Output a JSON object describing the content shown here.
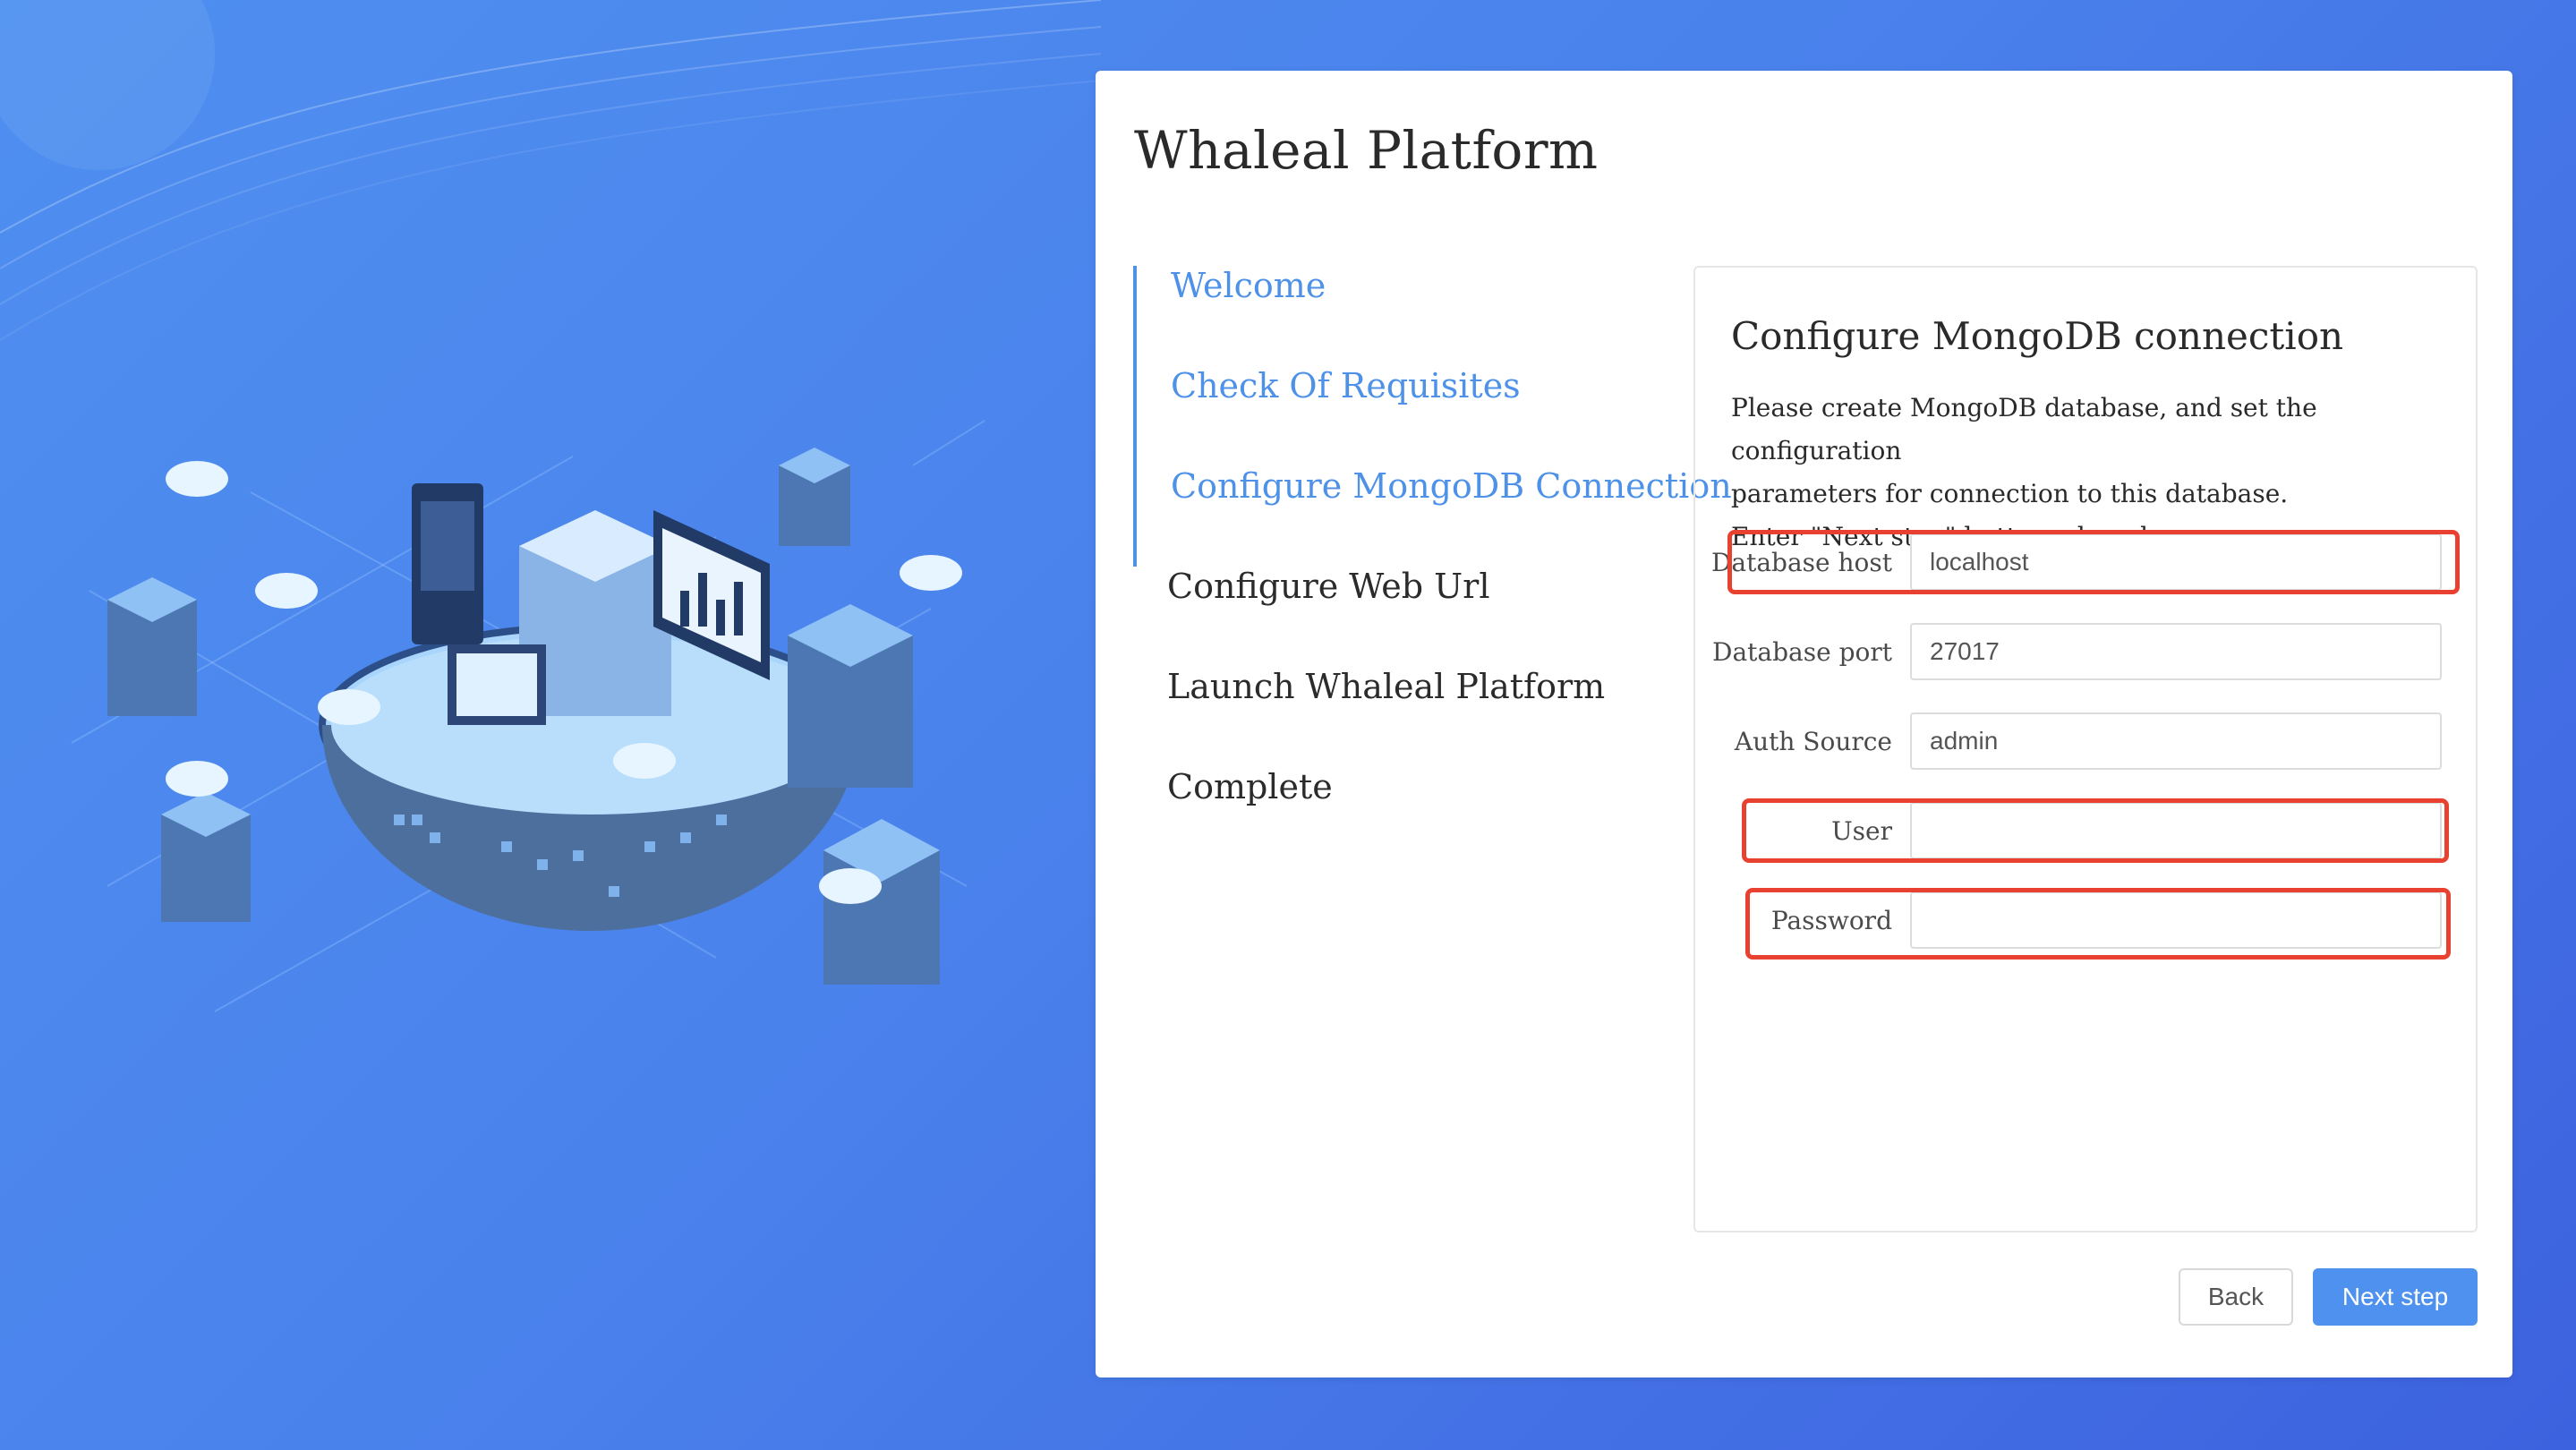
{
  "app": {
    "title": "Whaleal Platform"
  },
  "steps": [
    {
      "label": "Welcome",
      "state": "done"
    },
    {
      "label": "Check Of Requisites",
      "state": "done"
    },
    {
      "label": "Configure MongoDB Connection",
      "state": "current"
    },
    {
      "label": "Configure Web Url",
      "state": "todo"
    },
    {
      "label": "Launch Whaleal Platform",
      "state": "todo"
    },
    {
      "label": "Complete",
      "state": "todo"
    }
  ],
  "panel": {
    "title": "Configure MongoDB connection",
    "description_lines": [
      "Please create MongoDB database, and set the configuration",
      "parameters for connection to this database.",
      "Enter \"Next step\" button when done."
    ],
    "fields": [
      {
        "label": "Database host",
        "value": "localhost",
        "highlighted": true
      },
      {
        "label": "Database port",
        "value": "27017",
        "highlighted": false
      },
      {
        "label": "Auth Source",
        "value": "admin",
        "highlighted": false
      },
      {
        "label": "User",
        "value": "",
        "highlighted": true
      },
      {
        "label": "Password",
        "value": "",
        "highlighted": true
      }
    ]
  },
  "buttons": {
    "back": "Back",
    "next": "Next step"
  },
  "colors": {
    "accent": "#4e91e8",
    "highlight": "#e8412f",
    "background": "#4a82ec"
  },
  "illustration": {
    "icon": "cloud-data-center-illustration"
  }
}
